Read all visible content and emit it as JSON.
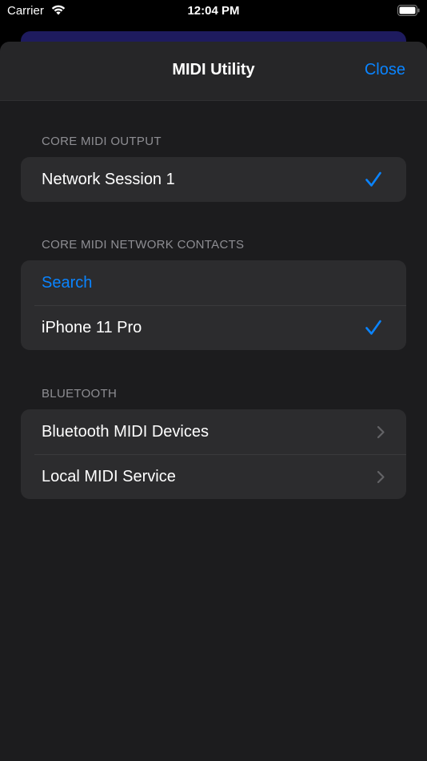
{
  "status_bar": {
    "carrier": "Carrier",
    "time": "12:04 PM"
  },
  "nav": {
    "title": "MIDI Utility",
    "close_label": "Close"
  },
  "sections": {
    "output": {
      "header": "CORE MIDI OUTPUT",
      "items": [
        {
          "label": "Network Session 1",
          "accessory": "checkmark-icon"
        }
      ]
    },
    "contacts": {
      "header": "CORE MIDI NETWORK CONTACTS",
      "items": [
        {
          "label": "Search",
          "accessory": "none"
        },
        {
          "label": "iPhone 11 Pro",
          "accessory": "checkmark-icon"
        }
      ]
    },
    "bluetooth": {
      "header": "BLUETOOTH",
      "items": [
        {
          "label": "Bluetooth MIDI Devices",
          "accessory": "chevron-right-icon"
        },
        {
          "label": "Local MIDI Service",
          "accessory": "chevron-right-icon"
        }
      ]
    }
  },
  "colors": {
    "accent": "#0a84ff",
    "sheet_background": "#1c1c1e",
    "cell_background": "#2c2c2e",
    "secondary_text": "#8e8e93"
  }
}
